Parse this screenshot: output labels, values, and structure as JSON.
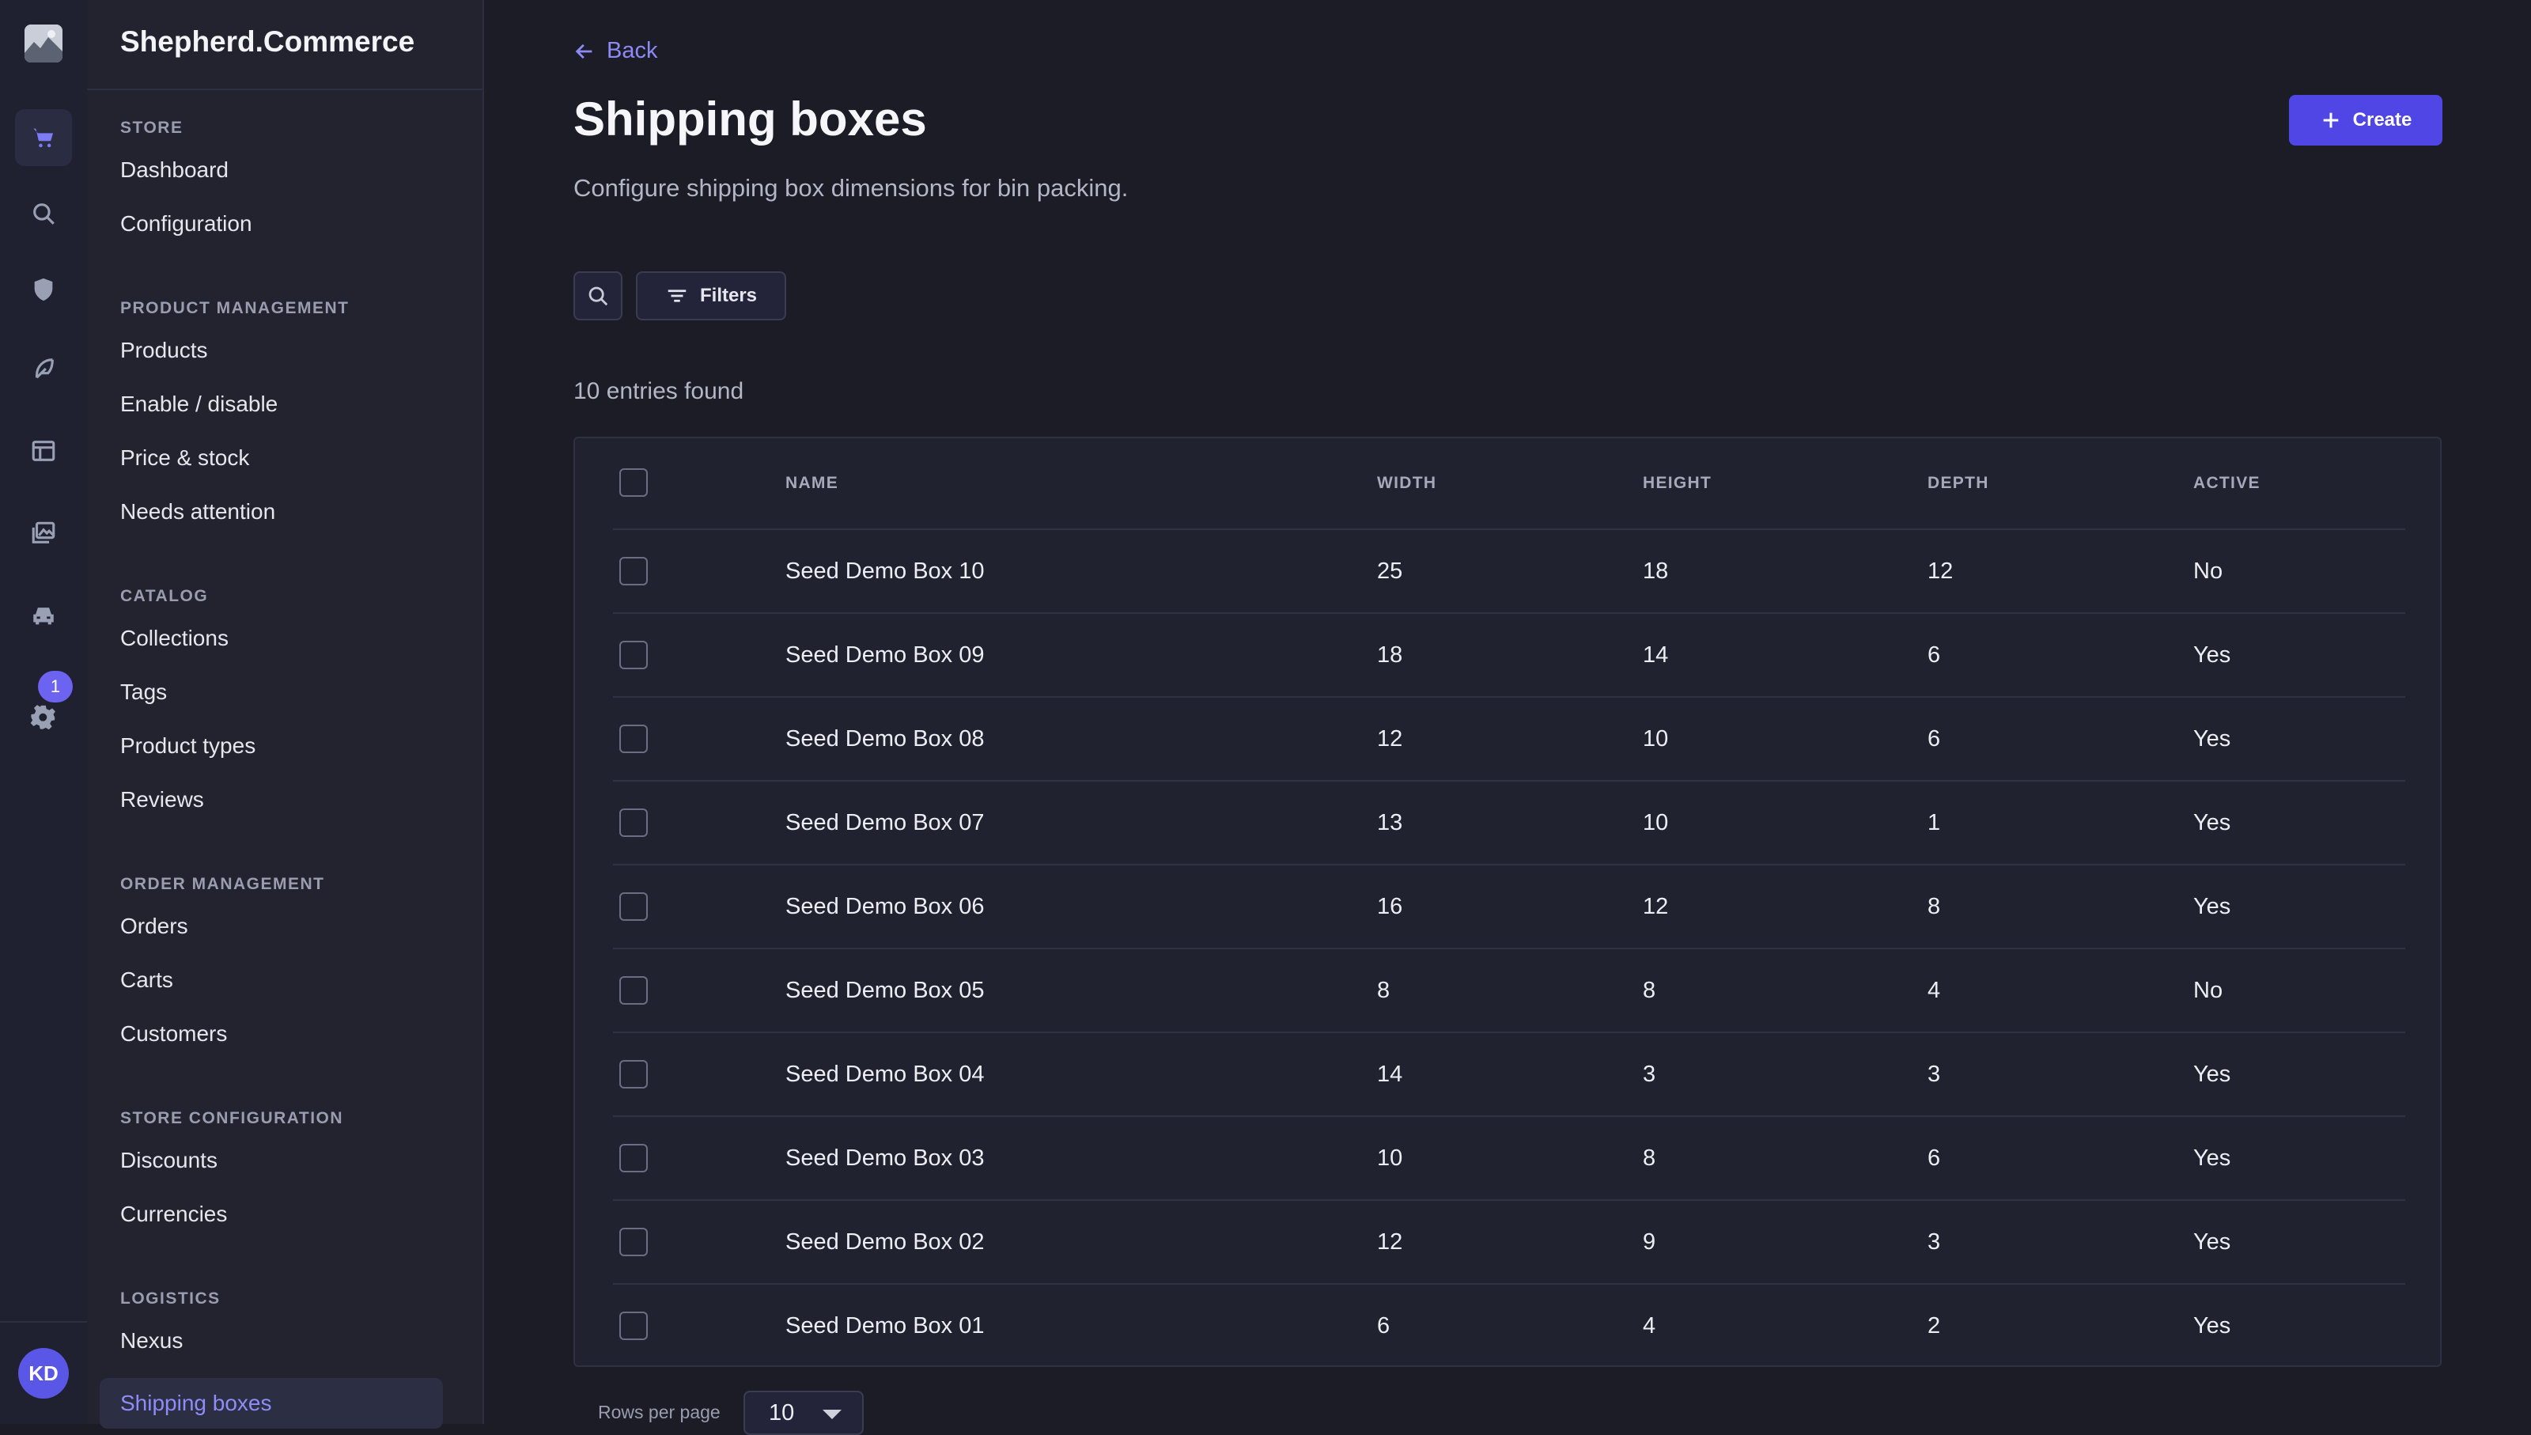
{
  "app": {
    "brand": "Shepherd.Commerce"
  },
  "rail": {
    "badge_count": "1",
    "avatar_initials": "KD"
  },
  "sidebar": {
    "groups": [
      {
        "heading": "STORE",
        "items": [
          "Dashboard",
          "Configuration"
        ]
      },
      {
        "heading": "PRODUCT MANAGEMENT",
        "items": [
          "Products",
          "Enable / disable",
          "Price & stock",
          "Needs attention"
        ]
      },
      {
        "heading": "CATALOG",
        "items": [
          "Collections",
          "Tags",
          "Product types",
          "Reviews"
        ]
      },
      {
        "heading": "ORDER MANAGEMENT",
        "items": [
          "Orders",
          "Carts",
          "Customers"
        ]
      },
      {
        "heading": "STORE CONFIGURATION",
        "items": [
          "Discounts",
          "Currencies"
        ]
      },
      {
        "heading": "LOGISTICS",
        "items": [
          "Nexus"
        ]
      }
    ],
    "active_item": "Shipping boxes"
  },
  "page": {
    "back_label": "Back",
    "title": "Shipping boxes",
    "subtitle": "Configure shipping box dimensions for bin packing.",
    "create_label": "Create",
    "filters_label": "Filters",
    "entries_found": "10 entries found"
  },
  "table": {
    "headers": {
      "name": "NAME",
      "width": "WIDTH",
      "height": "HEIGHT",
      "depth": "DEPTH",
      "active": "ACTIVE"
    },
    "rows": [
      {
        "name": "Seed Demo Box 10",
        "width": "25",
        "height": "18",
        "depth": "12",
        "active": "No"
      },
      {
        "name": "Seed Demo Box 09",
        "width": "18",
        "height": "14",
        "depth": "6",
        "active": "Yes"
      },
      {
        "name": "Seed Demo Box 08",
        "width": "12",
        "height": "10",
        "depth": "6",
        "active": "Yes"
      },
      {
        "name": "Seed Demo Box 07",
        "width": "13",
        "height": "10",
        "depth": "1",
        "active": "Yes"
      },
      {
        "name": "Seed Demo Box 06",
        "width": "16",
        "height": "12",
        "depth": "8",
        "active": "Yes"
      },
      {
        "name": "Seed Demo Box 05",
        "width": "8",
        "height": "8",
        "depth": "4",
        "active": "No"
      },
      {
        "name": "Seed Demo Box 04",
        "width": "14",
        "height": "3",
        "depth": "3",
        "active": "Yes"
      },
      {
        "name": "Seed Demo Box 03",
        "width": "10",
        "height": "8",
        "depth": "6",
        "active": "Yes"
      },
      {
        "name": "Seed Demo Box 02",
        "width": "12",
        "height": "9",
        "depth": "3",
        "active": "Yes"
      },
      {
        "name": "Seed Demo Box 01",
        "width": "6",
        "height": "4",
        "depth": "2",
        "active": "Yes"
      }
    ]
  },
  "pagination": {
    "rows_per_page_label": "Rows per page",
    "rows_per_page_value": "10"
  }
}
